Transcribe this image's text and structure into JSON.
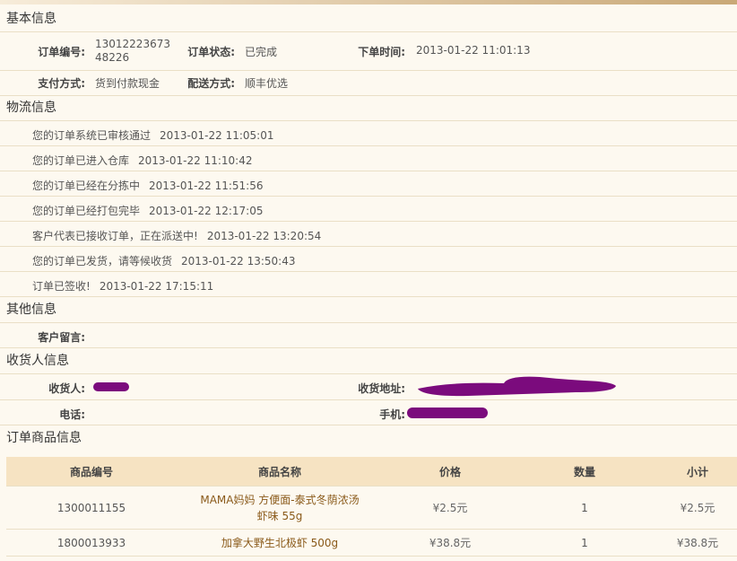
{
  "basic": {
    "title": "基本信息",
    "order_no_label": "订单编号:",
    "order_no_line1": "13012223673",
    "order_no_line2": "48226",
    "status_label": "订单状态:",
    "status_value": "已完成",
    "time_label": "下单时间:",
    "time_value": "2013-01-22 11:01:13",
    "pay_label": "支付方式:",
    "pay_value": "货到付款现金",
    "ship_label": "配送方式:",
    "ship_value": "顺丰优选"
  },
  "logistics": {
    "title": "物流信息",
    "entries": [
      {
        "text": "您的订单系统已审核通过",
        "time": "2013-01-22 11:05:01"
      },
      {
        "text": "您的订单已进入仓库",
        "time": "2013-01-22 11:10:42"
      },
      {
        "text": "您的订单已经在分拣中",
        "time": "2013-01-22 11:51:56"
      },
      {
        "text": "您的订单已经打包完毕",
        "time": "2013-01-22 12:17:05"
      },
      {
        "text": "客户代表已接收订单，正在派送中!",
        "time": "2013-01-22 13:20:54"
      },
      {
        "text": "您的订单已发货，请等候收货",
        "time": "2013-01-22 13:50:43"
      },
      {
        "text": "订单已签收!",
        "time": "2013-01-22 17:15:11"
      }
    ]
  },
  "other": {
    "title": "其他信息",
    "note_label": "客户留言:"
  },
  "receiver": {
    "title": "收货人信息",
    "name_label": "收货人:",
    "address_label": "收货地址:",
    "phone_label": "电话:",
    "mobile_label": "手机:"
  },
  "goods": {
    "title": "订单商品信息",
    "headers": [
      "商品编号",
      "商品名称",
      "价格",
      "数量",
      "小计"
    ],
    "rows": [
      {
        "code": "1300011155",
        "name_line1": "MAMA妈妈 方便面-泰式冬荫浓汤",
        "name_line2": "虾味 55g",
        "price": "¥2.5元",
        "qty": "1",
        "subtotal": "¥2.5元"
      },
      {
        "code": "1800013933",
        "name_line1": "加拿大野生北极虾 500g",
        "name_line2": "",
        "price": "¥38.8元",
        "qty": "1",
        "subtotal": "¥38.8元"
      }
    ]
  },
  "colors": {
    "header_bg": "#f6e3c2",
    "page_bg": "#fdf9f0",
    "redaction": "#7b0b7d"
  }
}
